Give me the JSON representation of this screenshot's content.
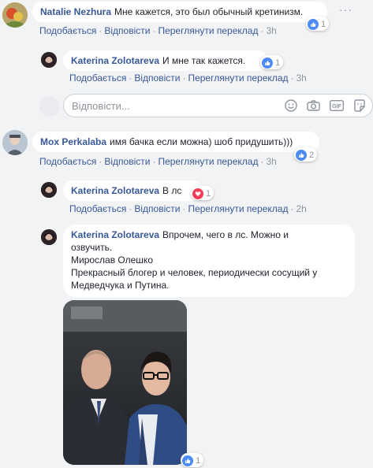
{
  "comments": [
    {
      "author": "Natalie Nezhura",
      "text": "Мне кажется, это был обычный кретинизм.",
      "actions": {
        "like": "Подобається",
        "reply": "Відповісти",
        "translate": "Переглянути переклад",
        "time": "3h"
      },
      "reaction": {
        "type": "like",
        "count": "1"
      }
    },
    {
      "author": "Katerina Zolotareva",
      "text": "И мне так кажется.",
      "actions": {
        "like": "Подобається",
        "reply": "Відповісти",
        "translate": "Переглянути переклад",
        "time": "3h"
      },
      "reaction": {
        "type": "like",
        "count": "1"
      }
    },
    {
      "author": "Mox Perkalaba",
      "text": "имя бачка если можна) шоб придушить)))",
      "actions": {
        "like": "Подобається",
        "reply": "Відповісти",
        "translate": "Переглянути переклад",
        "time": "3h"
      },
      "reaction": {
        "type": "like",
        "count": "2"
      }
    },
    {
      "author": "Katerina Zolotareva",
      "text": "В лс",
      "actions": {
        "like": "Подобається",
        "reply": "Відповісти",
        "translate": "Переглянути переклад",
        "time": "2h"
      },
      "reaction": {
        "type": "love",
        "count": "1"
      }
    },
    {
      "author": "Katerina Zolotareva",
      "text_lines": [
        "Впрочем, чего в лс. Можно и",
        "озвучить.",
        "Мирослав Олешко",
        "Прекрасный блогер и человек, периодически сосущий у",
        "Медведчука и Путина."
      ],
      "reaction": {
        "type": "like",
        "count": "1"
      }
    }
  ],
  "reply_input": {
    "placeholder": "Відповісти..."
  },
  "more_options": "···",
  "colors": {
    "link": "#385898",
    "like": "#4c8bf5",
    "love": "#f33e58",
    "muted": "#90949c",
    "background": "#f2f3f5"
  }
}
